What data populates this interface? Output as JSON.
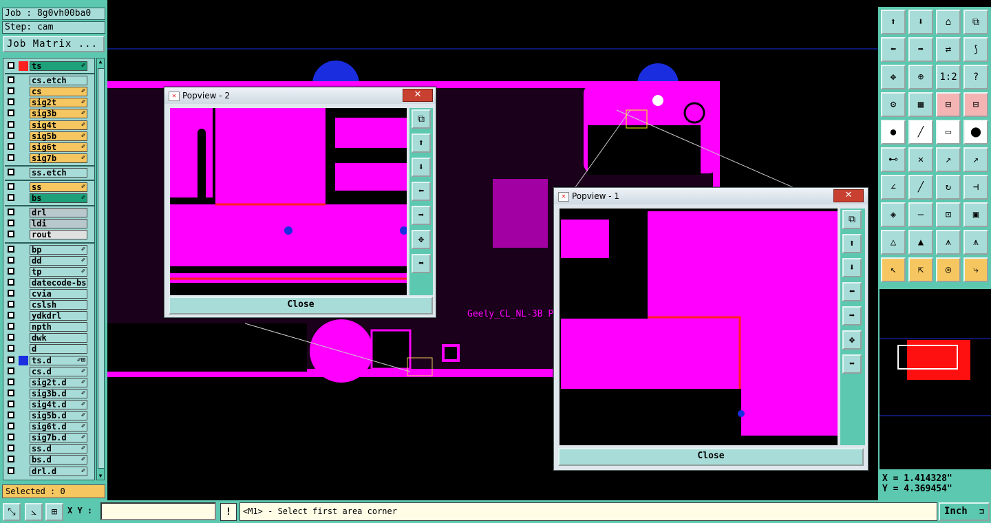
{
  "job": {
    "label": "Job : 8g0vh00ba0",
    "step": "Step: cam",
    "matrix_button": "Job Matrix ..."
  },
  "layers": [
    {
      "name": "ts",
      "color": "#ff2020",
      "bg": "#1ea07a",
      "mark": "✐"
    },
    {
      "name": "cs.etch",
      "color": "",
      "bg": "#a8dcd8",
      "mark": ""
    },
    {
      "name": "cs",
      "color": "",
      "bg": "#f6c760",
      "mark": "✐"
    },
    {
      "name": "sig2t",
      "color": "",
      "bg": "#f6c760",
      "mark": "✐"
    },
    {
      "name": "sig3b",
      "color": "",
      "bg": "#f6c760",
      "mark": "✐"
    },
    {
      "name": "sig4t",
      "color": "",
      "bg": "#f6c760",
      "mark": "✐"
    },
    {
      "name": "sig5b",
      "color": "",
      "bg": "#f6c760",
      "mark": "✐"
    },
    {
      "name": "sig6t",
      "color": "",
      "bg": "#f6c760",
      "mark": "✐"
    },
    {
      "name": "sig7b",
      "color": "",
      "bg": "#f6c760",
      "mark": "✐"
    },
    {
      "name": "ss.etch",
      "color": "",
      "bg": "#a8dcd8",
      "mark": ""
    },
    {
      "name": "ss",
      "color": "",
      "bg": "#f6c760",
      "mark": "✐"
    },
    {
      "name": "bs",
      "color": "",
      "bg": "#1ea07a",
      "mark": "✐"
    },
    {
      "name": "drl",
      "color": "",
      "bg": "#b8c8cc",
      "mark": ""
    },
    {
      "name": "ldi",
      "color": "",
      "bg": "#b8c8cc",
      "mark": ""
    },
    {
      "name": "rout",
      "color": "",
      "bg": "#e0e0e0",
      "mark": ""
    },
    {
      "name": "bp",
      "color": "",
      "bg": "#a8dcd8",
      "mark": "✐"
    },
    {
      "name": "dd",
      "color": "",
      "bg": "#a8dcd8",
      "mark": "✐"
    },
    {
      "name": "tp",
      "color": "",
      "bg": "#a8dcd8",
      "mark": "✐"
    },
    {
      "name": "datecode-bs",
      "color": "",
      "bg": "#a8dcd8",
      "mark": ""
    },
    {
      "name": "cvia",
      "color": "",
      "bg": "#a8dcd8",
      "mark": ""
    },
    {
      "name": "cslsh",
      "color": "",
      "bg": "#a8dcd8",
      "mark": ""
    },
    {
      "name": "ydkdrl",
      "color": "",
      "bg": "#a8dcd8",
      "mark": ""
    },
    {
      "name": "npth",
      "color": "",
      "bg": "#a8dcd8",
      "mark": ""
    },
    {
      "name": "dwk",
      "color": "",
      "bg": "#a8dcd8",
      "mark": ""
    },
    {
      "name": "d",
      "color": "",
      "bg": "#a8dcd8",
      "mark": ""
    },
    {
      "name": "ts.d",
      "color": "#1a2ee0",
      "bg": "#a8dcd8",
      "mark": "✐⊞"
    },
    {
      "name": "cs.d",
      "color": "",
      "bg": "#a8dcd8",
      "mark": "✐"
    },
    {
      "name": "sig2t.d",
      "color": "",
      "bg": "#a8dcd8",
      "mark": "✐"
    },
    {
      "name": "sig3b.d",
      "color": "",
      "bg": "#a8dcd8",
      "mark": "✐"
    },
    {
      "name": "sig4t.d",
      "color": "",
      "bg": "#a8dcd8",
      "mark": "✐"
    },
    {
      "name": "sig5b.d",
      "color": "",
      "bg": "#a8dcd8",
      "mark": "✐"
    },
    {
      "name": "sig6t.d",
      "color": "",
      "bg": "#a8dcd8",
      "mark": "✐"
    },
    {
      "name": "sig7b.d",
      "color": "",
      "bg": "#a8dcd8",
      "mark": "✐"
    },
    {
      "name": "ss.d",
      "color": "",
      "bg": "#a8dcd8",
      "mark": "✐"
    },
    {
      "name": "bs.d",
      "color": "",
      "bg": "#a8dcd8",
      "mark": "✐"
    },
    {
      "name": "drl.d",
      "color": "",
      "bg": "#a8dcd8",
      "mark": "✐"
    }
  ],
  "selected": "Selected : 0",
  "canvas": {
    "board_label": "Geely_CL_NL-3B P"
  },
  "popview2": {
    "title": "Popview - 2",
    "close_x": "✕",
    "close_button": "Close"
  },
  "popview1": {
    "title": "Popview - 1",
    "close_x": "✕",
    "close_button": "Close"
  },
  "coords": {
    "x": "X = 1.414328\"",
    "y": "Y = 4.369454\""
  },
  "bottom": {
    "xy_label": "X Y :",
    "xy_value": "",
    "excl": "!",
    "prompt": "<M1> - Select first area corner",
    "unit": "Inch"
  },
  "colors": {
    "accent": "#5cc8b0",
    "copper": "#ff00ff",
    "trace": "#ff2020",
    "via": "#1a2ee0"
  }
}
